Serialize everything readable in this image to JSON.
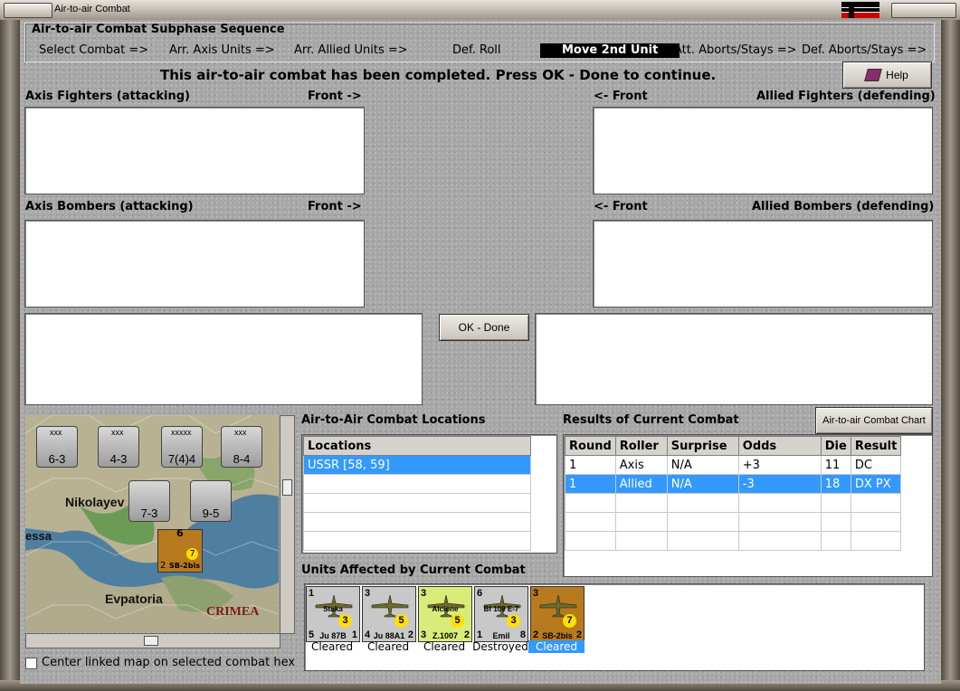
{
  "window": {
    "title": "Air-to-air Combat"
  },
  "sequence": {
    "group_label": "Air-to-air Combat Subphase Sequence",
    "steps": [
      "Select Combat =>",
      "Arr. Axis Units =>",
      "Arr. Allied Units =>",
      "Def. Roll",
      "Move 2nd Unit",
      "Att. Aborts/Stays =>",
      "Def. Aborts/Stays =>"
    ],
    "active_step": "Move 2nd Unit"
  },
  "message": "This air-to-air combat has been completed.  Press OK - Done to continue.",
  "help_button": "Help",
  "panels": {
    "axis_fighters": "Axis Fighters (attacking)",
    "axis_fighters_front": "Front ->",
    "allied_fighters": "Allied Fighters (defending)",
    "allied_fighters_front": "<- Front",
    "axis_bombers": "Axis Bombers (attacking)",
    "axis_bombers_front": "Front ->",
    "allied_bombers": "Allied Bombers (defending)",
    "allied_bombers_front": "<- Front"
  },
  "ok_button": "OK - Done",
  "map": {
    "labels": [
      "Nikolayev",
      "essa",
      "Evpatoria",
      "CRIMEA"
    ],
    "units": [
      {
        "top": "xxx",
        "value": "6-3"
      },
      {
        "top": "xxx",
        "value": "4-3"
      },
      {
        "top": "xxxxx",
        "value": "7(4)4"
      },
      {
        "top": "xxx",
        "value": "8-4"
      },
      {
        "top": "",
        "value": "7-3"
      },
      {
        "top": "",
        "value": "9-5"
      }
    ],
    "air_unit": {
      "name": "SB-2bis",
      "left": "2",
      "right": "2",
      "die": "7",
      "top": "6"
    },
    "center_checkbox_label": "Center linked map on selected combat hex",
    "center_checked": false
  },
  "locations": {
    "title": "Air-to-Air Combat Locations",
    "header": "Locations",
    "rows": [
      "USSR [58, 59]"
    ],
    "selected": 0
  },
  "results": {
    "title": "Results of Current Combat",
    "chart_button": "Air-to-air Combat Chart",
    "columns": [
      "Round",
      "Roller",
      "Surprise",
      "Odds",
      "Die",
      "Result"
    ],
    "rows": [
      [
        "1",
        "Axis",
        "N/A",
        "+3",
        "11",
        "DC"
      ],
      [
        "1",
        "Allied",
        "N/A",
        "-3",
        "18",
        "DX PX"
      ]
    ],
    "selected": 1
  },
  "affected": {
    "title": "Units Affected by Current Combat",
    "units": [
      {
        "name": "Ju 87B",
        "sub": "Stuka",
        "a": "1",
        "b": "5",
        "c": "1",
        "die": "3",
        "status": "Cleared",
        "bg": "#c8c8c8"
      },
      {
        "name": "Ju 88A1",
        "sub": "",
        "a": "3",
        "b": "4",
        "c": "2",
        "die": "5",
        "status": "Cleared",
        "bg": "#c8c8c8"
      },
      {
        "name": "Z.1007",
        "sub": "Alcione",
        "a": "3",
        "b": "3",
        "c": "2",
        "die": "5",
        "status": "Cleared",
        "bg": "#d9ec7a"
      },
      {
        "name": "Emil",
        "sub": "Bf 109 E-7",
        "a": "6",
        "b": "1",
        "c": "8",
        "die": "3",
        "status": "Destroyed",
        "bg": "#c8c8c8"
      },
      {
        "name": "SB-2bis",
        "sub": "",
        "a": "3",
        "b": "2",
        "c": "2",
        "die": "7",
        "status": "Cleared",
        "bg": "#b77a1e"
      }
    ],
    "selected": 4
  },
  "colors": {
    "selection": "#3399ff",
    "active_step_bg": "#000000"
  }
}
